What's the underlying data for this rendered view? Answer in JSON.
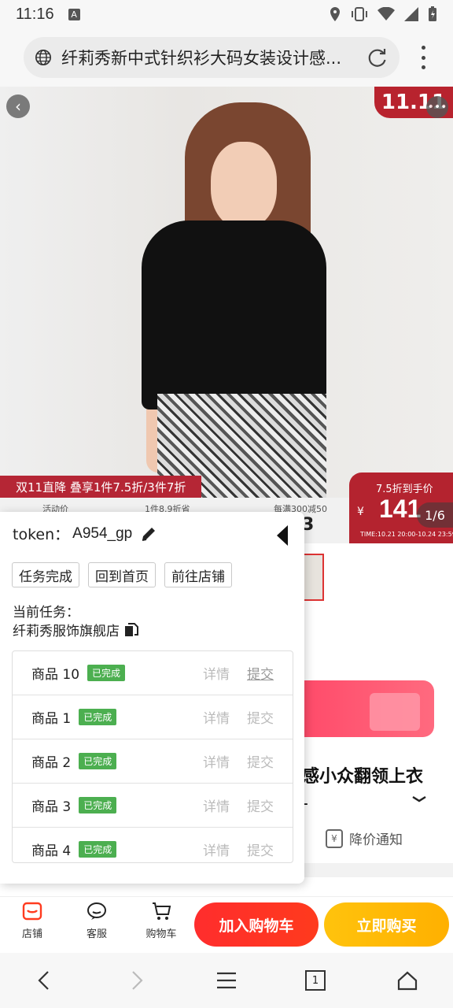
{
  "status_bar": {
    "time": "11:16",
    "a_icon_label": "A"
  },
  "browser": {
    "url_text": "纤莉秀新中式针织衫大码女装设计感..."
  },
  "hero": {
    "badge_text": "11.11",
    "back_icon": "back-arrow-icon",
    "more_icon": "more-icon",
    "promo_text": "双11直降 叠享1件7.5折/3件7折",
    "promo_sub": [
      "活动价",
      "1件8.9折省",
      "每满300减50"
    ],
    "promo_partial_value": "3",
    "price_title": "7.5折到手价",
    "price_currency": "¥",
    "price_value": "141",
    "price_time": "TIME:10.21 20:00-10.24 23:59",
    "page_indicator": "1/6"
  },
  "panel": {
    "token_label": "token：",
    "token_value": "A954_gp",
    "buttons": [
      "任务完成",
      "回到首页",
      "前往店铺"
    ],
    "current_task_label": "当前任务：",
    "current_task_shop": "纤莉秀服饰旗舰店",
    "tasks": [
      {
        "name": "商品 10",
        "status": "已完成",
        "detail": "详情",
        "submit": "提交"
      },
      {
        "name": "商品 1",
        "status": "已完成",
        "detail": "详情",
        "submit": "提交"
      },
      {
        "name": "商品 2",
        "status": "已完成",
        "detail": "详情",
        "submit": "提交"
      },
      {
        "name": "商品 3",
        "status": "已完成",
        "detail": "详情",
        "submit": "提交"
      },
      {
        "name": "商品 4",
        "status": "已完成",
        "detail": "详情",
        "submit": "提交"
      }
    ]
  },
  "product": {
    "title_fragment": "感小众翻领上衣",
    "title_dash": "-",
    "price_notify": "降价通知"
  },
  "bottom_bar": {
    "shop": "店铺",
    "service": "客服",
    "cart": "购物车",
    "add_to_cart": "加入购物车",
    "buy_now": "立即购买"
  },
  "nav": {
    "tabs_count": "1"
  },
  "colors": {
    "accent_red": "#b4232f",
    "cart_red": "#ff2d2d",
    "buy_yellow": "#ffb800",
    "done_green": "#4caf50"
  }
}
